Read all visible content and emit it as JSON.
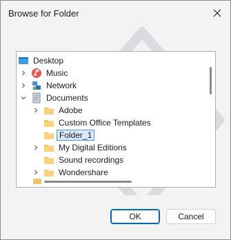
{
  "dialog": {
    "title": "Browse for Folder",
    "ok_label": "OK",
    "cancel_label": "Cancel"
  },
  "tree": [
    {
      "label": "Desktop",
      "icon": "desktop-icon",
      "depth": 0,
      "expander": "none"
    },
    {
      "label": "Music",
      "icon": "music-icon",
      "depth": 1,
      "expander": "collapsed"
    },
    {
      "label": "Network",
      "icon": "network-icon",
      "depth": 1,
      "expander": "collapsed"
    },
    {
      "label": "Documents",
      "icon": "documents-icon",
      "depth": 1,
      "expander": "expanded"
    },
    {
      "label": "Adobe",
      "icon": "folder-icon",
      "depth": 2,
      "expander": "collapsed"
    },
    {
      "label": "Custom Office Templates",
      "icon": "folder-icon",
      "depth": 2,
      "expander": "none"
    },
    {
      "label": "Folder_1",
      "icon": "folder-icon",
      "depth": 2,
      "expander": "none",
      "selected": true
    },
    {
      "label": "My Digital Editions",
      "icon": "folder-icon",
      "depth": 2,
      "expander": "collapsed"
    },
    {
      "label": "Sound recordings",
      "icon": "folder-icon",
      "depth": 2,
      "expander": "none"
    },
    {
      "label": "Wondershare",
      "icon": "folder-icon",
      "depth": 2,
      "expander": "collapsed"
    }
  ],
  "colors": {
    "accent": "#0067c0",
    "selection_fill": "#d9e9fb",
    "folder": "#f2c36b"
  }
}
